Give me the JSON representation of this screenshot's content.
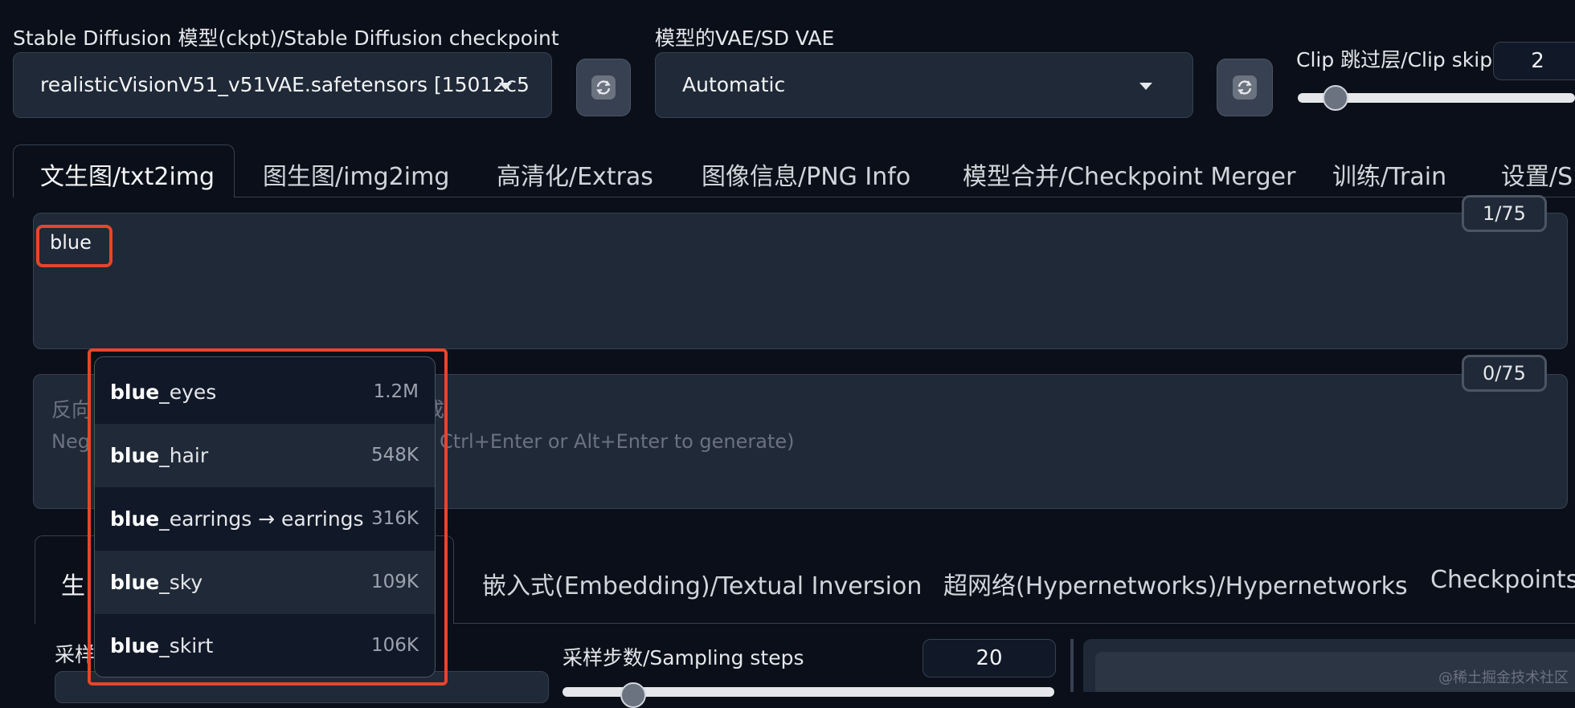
{
  "header": {
    "checkpoint_label": "Stable Diffusion 模型(ckpt)/Stable Diffusion checkpoint",
    "checkpoint_value": "realisticVisionV51_v51VAE.safetensors [15012c5",
    "vae_label": "模型的VAE/SD VAE",
    "vae_value": "Automatic",
    "clip_label": "Clip 跳过层/Clip skip",
    "clip_value": "2",
    "clip_slider": {
      "value": 2,
      "min": 1,
      "max": 12
    }
  },
  "tabs": [
    {
      "label": "文生图/txt2img",
      "active": true
    },
    {
      "label": "图生图/img2img"
    },
    {
      "label": "高清化/Extras"
    },
    {
      "label": "图像信息/PNG Info"
    },
    {
      "label": "模型合并/Checkpoint Merger"
    },
    {
      "label": "训练/Train"
    },
    {
      "label": "设置/S"
    }
  ],
  "prompt": {
    "value": "blue",
    "counter": "1/75"
  },
  "negative": {
    "counter": "0/75",
    "placeholder_line1_start": "反向",
    "placeholder_line1_end": "成",
    "placeholder_line2_start": "Neg",
    "placeholder_line2_end": "Ctrl+Enter or Alt+Enter to generate)"
  },
  "autocomplete": {
    "items": [
      {
        "bold": "blue",
        "rest": "_eyes",
        "count": "1.2M"
      },
      {
        "bold": "blue",
        "rest": "_hair",
        "count": "548K"
      },
      {
        "bold": "blue",
        "rest": "_earrings → earrings",
        "count": "316K"
      },
      {
        "bold": "blue",
        "rest": "_sky",
        "count": "109K"
      },
      {
        "bold": "blue",
        "rest": "_skirt",
        "count": "106K"
      }
    ]
  },
  "subtabs": [
    {
      "label": "生",
      "active": true
    },
    {
      "label": "嵌入式(Embedding)/Textual Inversion"
    },
    {
      "label": "超网络(Hypernetworks)/Hypernetworks"
    },
    {
      "label": "Checkpoints"
    }
  ],
  "sampling": {
    "method_label_partial": "采样",
    "steps_label": "采样步数/Sampling steps",
    "steps_value": "20"
  },
  "watermark": "@稀土掘金技术社区",
  "colors": {
    "highlight_red": "#e8452b",
    "background": "#0b0f19",
    "panel": "#1f2937"
  }
}
